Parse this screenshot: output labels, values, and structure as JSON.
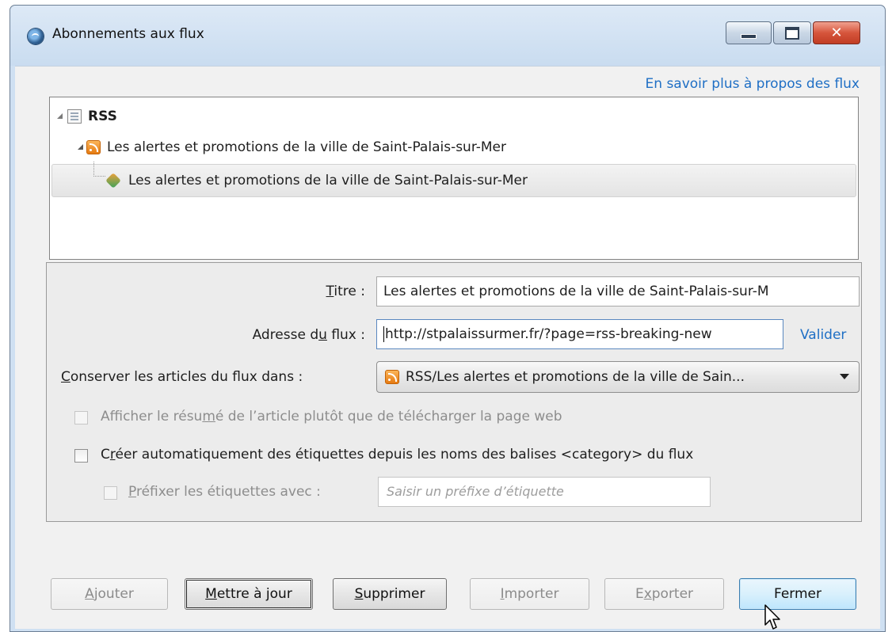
{
  "window": {
    "title": "Abonnements aux flux",
    "controls": {
      "minimize": "minimize",
      "maximize": "maximize",
      "close": "close"
    }
  },
  "header": {
    "learn_more_link": "En savoir plus à propos des flux"
  },
  "tree": {
    "root": {
      "label": "RSS",
      "icon": "folder-icon"
    },
    "children": [
      {
        "label": "Les alertes et promotions de la ville de Saint-Palais-sur-Mer",
        "icon": "rss-icon"
      },
      {
        "label": "Les alertes et promotions de la ville de Saint-Palais-sur-Mer",
        "icon": "feed-item-icon",
        "selected": true
      }
    ]
  },
  "form": {
    "title_label_pre": "",
    "title_label_key": "T",
    "title_label_post": "itre :",
    "title_value": "Les alertes et promotions de la ville de Saint-Palais-sur-M",
    "url_label_pre": "Adresse d",
    "url_label_key": "u",
    "url_label_post": " flux :",
    "url_value": "http://stpalaissurmer.fr/?page=rss-breaking-new",
    "validate_link": "Valider",
    "folder_label_key": "C",
    "folder_label_post": "onserver les articles du flux dans :",
    "folder_value": "RSS/Les alertes et promotions de la ville de Sain...",
    "summary_pre": "Afficher le résu",
    "summary_key": "m",
    "summary_post": "é de l’article plutôt que de télécharger la page web",
    "autotags_pre": "C",
    "autotags_key": "r",
    "autotags_post": "éer automatiquement des étiquettes depuis les noms des balises <category> du flux",
    "prefix_key": "P",
    "prefix_post": "réfixer les étiquettes avec :",
    "prefix_placeholder": "Saisir un préfixe d’étiquette"
  },
  "buttons": {
    "add_key": "A",
    "add_post": "jouter",
    "update_key": "M",
    "update_post": "ettre à jour",
    "delete_key": "S",
    "delete_post": "upprimer",
    "import_key": "I",
    "import_post": "mporter",
    "export_pre": "E",
    "export_key": "x",
    "export_post": "porter",
    "close": "Fermer"
  },
  "colors": {
    "link": "#1f6fc5",
    "window_frame": "#cfe0f2",
    "dialog_bg": "#f1f1f1"
  }
}
